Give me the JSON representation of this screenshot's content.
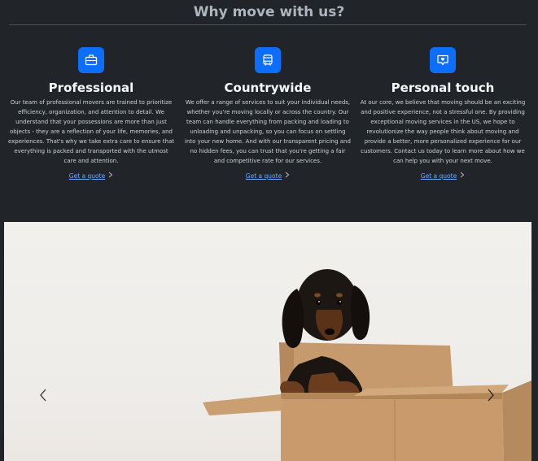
{
  "section": {
    "title": "Why move with us?"
  },
  "features": [
    {
      "icon": "briefcase-icon",
      "title": "Professional",
      "body": "Our team of professional movers are trained to prioritize efficiency, organization, and attention to detail. We understand that your possessions are more than just objects - they are a reflection of your life, memories, and experiences. That's why we take extra care to ensure that everything is packed and transported with the utmost care and attention.",
      "link": "Get a quote"
    },
    {
      "icon": "bus-icon",
      "title": "Countrywide",
      "body": "We offer a range of services to suit your individual needs, whether you're moving locally or across the country. Our team can handle everything from packing and loading to unloading and unpacking, so you can focus on settling into your new home. And with our transparent pricing and no hidden fees, you can trust that you're getting a fair and competitive rate for our services.",
      "link": "Get a quote"
    },
    {
      "icon": "chat-heart-icon",
      "title": "Personal touch",
      "body": "At our core, we believe that moving should be an exciting and positive experience, not a stressful one. By providing exceptional moving services in the US, we hope to revolutionize the way people think about moving and provide a better, more personalized experience for our customers. Contact us today to learn more about how we can help you with your next move.",
      "link": "Get a quote"
    }
  ],
  "carousel": {
    "image": "dachshund-in-cardboard-box",
    "prev_icon": "chevron-left-icon",
    "next_icon": "chevron-right-icon"
  },
  "colors": {
    "background": "#212529",
    "accent": "#0d6efd",
    "link": "#6ea8fe"
  }
}
